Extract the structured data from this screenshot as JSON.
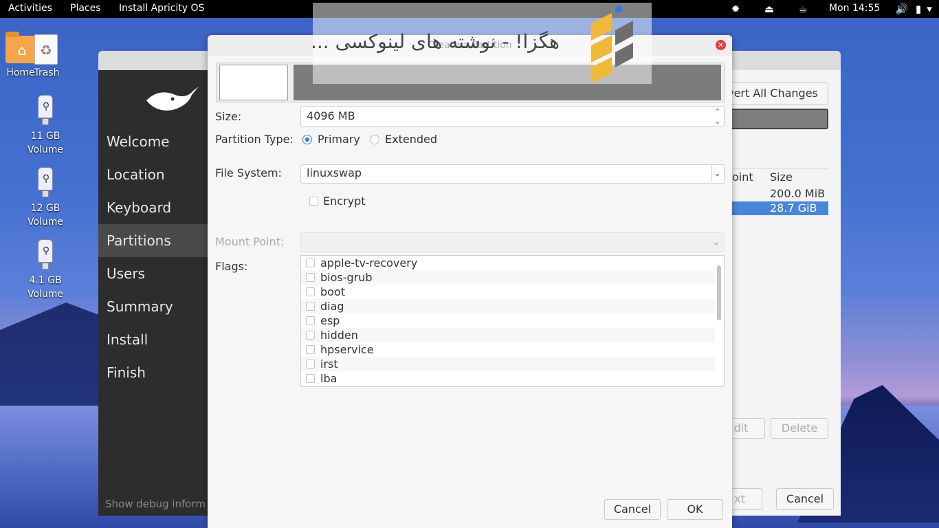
{
  "topbar": {
    "activities": "Activities",
    "places": "Places",
    "app_name": "Install Apricity OS",
    "clock": "Mon 14:55"
  },
  "desktop": {
    "home_label": "Home",
    "trash_label": "Trash",
    "volumes": [
      {
        "line1": "11 GB",
        "line2": "Volume"
      },
      {
        "line1": "12 GB",
        "line2": "Volume"
      },
      {
        "line1": "4.1 GB",
        "line2": "Volume"
      }
    ]
  },
  "installer": {
    "sidebar": [
      {
        "label": "Welcome"
      },
      {
        "label": "Location"
      },
      {
        "label": "Keyboard"
      },
      {
        "label": "Partitions"
      },
      {
        "label": "Users"
      },
      {
        "label": "Summary"
      },
      {
        "label": "Install"
      },
      {
        "label": "Finish"
      }
    ],
    "debug_text": "Show debug inform",
    "revert_label": "vert All Changes",
    "table": {
      "col_point": "oint",
      "col_size": "Size",
      "rows": [
        {
          "size": "200.0 MiB"
        },
        {
          "size": "28.7 GiB"
        }
      ]
    },
    "edit_label": "dit",
    "delete_label": "Delete",
    "next_label": "xt",
    "cancel_label": "Cancel"
  },
  "dialog": {
    "title": "Create a Partition",
    "size_label": "Size:",
    "size_value": "4096 MB",
    "partition_type_label": "Partition Type:",
    "primary_label": "Primary",
    "extended_label": "Extended",
    "fs_label": "File System:",
    "fs_value": "linuxswap",
    "encrypt_label": "Encrypt",
    "mount_label": "Mount Point:",
    "flags_label": "Flags:",
    "flags": [
      "apple-tv-recovery",
      "bios-grub",
      "boot",
      "diag",
      "esp",
      "hidden",
      "hpservice",
      "irst",
      "lba"
    ],
    "cancel_label": "Cancel",
    "ok_label": "OK"
  },
  "watermark": {
    "text": "هگزا! - نوشته های لینوکسی ..."
  },
  "colors": {
    "accent": "#3b82d6",
    "selection": "#4a86d8",
    "close": "#e03e3e"
  }
}
